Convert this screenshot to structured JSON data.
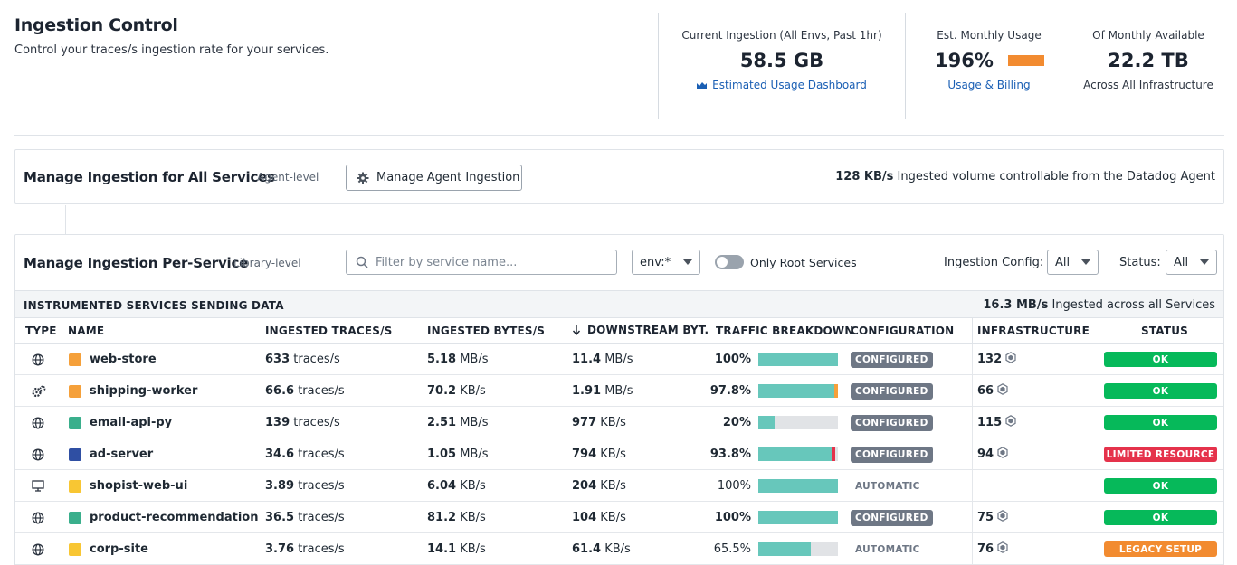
{
  "header": {
    "title": "Ingestion Control",
    "subtitle": "Control your traces/s ingestion rate for your services."
  },
  "stats": {
    "current": {
      "label": "Current Ingestion (All Envs, Past 1hr)",
      "value": "58.5 GB",
      "link": "Estimated Usage Dashboard"
    },
    "monthly": {
      "label": "Est. Monthly Usage",
      "value": "196%",
      "link": "Usage & Billing",
      "bar_color": "#f28b30"
    },
    "available": {
      "label": "Of Monthly Available",
      "value": "22.2 TB",
      "note": "Across All Infrastructure"
    }
  },
  "agent_panel": {
    "title": "Manage Ingestion for All Services",
    "level": "Agent-level",
    "button": "Manage Agent Ingestion",
    "volume_value": "128 KB/s",
    "volume_text": "Ingested volume controllable from the Datadog Agent"
  },
  "service_panel": {
    "title": "Manage Ingestion Per-Service",
    "level": "Library-level",
    "search_placeholder": "Filter by service name...",
    "env_select": "env:*",
    "toggle_label": "Only Root Services",
    "config_label": "Ingestion Config:",
    "config_value": "All",
    "status_label": "Status:",
    "status_value": "All"
  },
  "band": {
    "title": "INSTRUMENTED SERVICES SENDING DATA",
    "total_value": "16.3 MB/s",
    "total_text": "Ingested across all Services"
  },
  "columns": {
    "type": "TYPE",
    "name": "NAME",
    "traces": "INGESTED TRACES/S",
    "bytes": "INGESTED BYTES/S",
    "downstream": "DOWNSTREAM BYT...",
    "traffic": "TRAFFIC BREAKDOWN",
    "config": "CONFIGURATION",
    "infra": "INFRASTRUCTURE",
    "status": "STATUS"
  },
  "colors": {
    "ok": "#06b95a",
    "limited": "#e5324b",
    "legacy": "#f28b30",
    "teal": "#67c7bb",
    "orange": "#f5a03a",
    "green": "#3aaf8c",
    "blue": "#2f4fa3",
    "yellow": "#f8c633"
  },
  "rows": [
    {
      "type_icon": "globe-icon",
      "color": "#f5a03a",
      "name": "web-store",
      "traces_num": "633",
      "traces_unit": "traces/s",
      "bytes_num": "5.18",
      "bytes_unit": "MB/s",
      "down_num": "11.4",
      "down_unit": "MB/s",
      "pct": "100%",
      "pct_bold": true,
      "fill": 1.0,
      "tip": "",
      "config": "CONFIGURED",
      "config_kind": "cfg",
      "infra": "132",
      "status": "OK",
      "status_kind": "ok"
    },
    {
      "type_icon": "gears-icon",
      "color": "#f5a03a",
      "name": "shipping-worker",
      "traces_num": "66.6",
      "traces_unit": "traces/s",
      "bytes_num": "70.2",
      "bytes_unit": "KB/s",
      "down_num": "1.91",
      "down_unit": "MB/s",
      "pct": "97.8%",
      "pct_bold": true,
      "fill": 0.978,
      "tip": "#f5a03a",
      "config": "CONFIGURED",
      "config_kind": "cfg",
      "infra": "66",
      "status": "OK",
      "status_kind": "ok"
    },
    {
      "type_icon": "globe-icon",
      "color": "#3aaf8c",
      "name": "email-api-py",
      "traces_num": "139",
      "traces_unit": "traces/s",
      "bytes_num": "2.51",
      "bytes_unit": "MB/s",
      "down_num": "977",
      "down_unit": "KB/s",
      "pct": "20%",
      "pct_bold": true,
      "fill": 0.2,
      "tip": "",
      "config": "CONFIGURED",
      "config_kind": "cfg",
      "infra": "115",
      "status": "OK",
      "status_kind": "ok"
    },
    {
      "type_icon": "globe-icon",
      "color": "#2f4fa3",
      "name": "ad-server",
      "traces_num": "34.6",
      "traces_unit": "traces/s",
      "bytes_num": "1.05",
      "bytes_unit": "MB/s",
      "down_num": "794",
      "down_unit": "KB/s",
      "pct": "93.8%",
      "pct_bold": true,
      "fill": 0.938,
      "tip": "#e5324b",
      "config": "CONFIGURED",
      "config_kind": "cfg",
      "infra": "94",
      "status": "LIMITED RESOURCE",
      "status_kind": "limited"
    },
    {
      "type_icon": "monitor-icon",
      "color": "#f8c633",
      "name": "shopist-web-ui",
      "traces_num": "3.89",
      "traces_unit": "traces/s",
      "bytes_num": "6.04",
      "bytes_unit": "KB/s",
      "down_num": "204",
      "down_unit": "KB/s",
      "pct": "100%",
      "pct_bold": false,
      "fill": 1.0,
      "tip": "",
      "config": "AUTOMATIC",
      "config_kind": "auto",
      "infra": "",
      "status": "OK",
      "status_kind": "ok"
    },
    {
      "type_icon": "globe-icon",
      "color": "#3aaf8c",
      "name": "product-recommendation",
      "traces_num": "36.5",
      "traces_unit": "traces/s",
      "bytes_num": "81.2",
      "bytes_unit": "KB/s",
      "down_num": "104",
      "down_unit": "KB/s",
      "pct": "100%",
      "pct_bold": true,
      "fill": 1.0,
      "tip": "",
      "config": "CONFIGURED",
      "config_kind": "cfg",
      "infra": "75",
      "status": "OK",
      "status_kind": "ok"
    },
    {
      "type_icon": "globe-icon",
      "color": "#f8c633",
      "name": "corp-site",
      "traces_num": "3.76",
      "traces_unit": "traces/s",
      "bytes_num": "14.1",
      "bytes_unit": "KB/s",
      "down_num": "61.4",
      "down_unit": "KB/s",
      "pct": "65.5%",
      "pct_bold": false,
      "fill": 0.655,
      "tip": "",
      "config": "AUTOMATIC",
      "config_kind": "auto",
      "infra": "76",
      "status": "LEGACY SETUP",
      "status_kind": "legacy"
    }
  ]
}
